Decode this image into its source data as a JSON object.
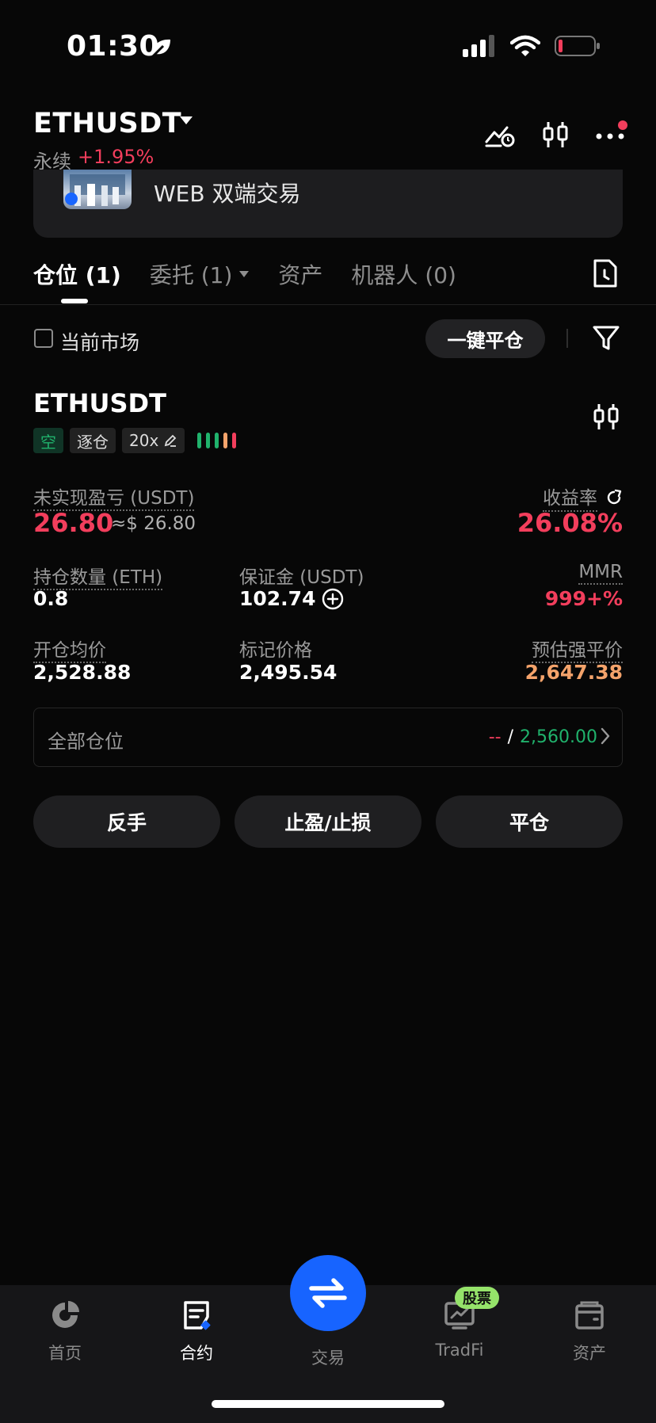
{
  "status_bar": {
    "time": "01:30"
  },
  "header": {
    "pair": "ETHUSDT",
    "contract_type": "永续",
    "change": "+1.95%"
  },
  "banner": {
    "text": "WEB 双端交易"
  },
  "tabs": [
    {
      "label": "仓位 (1)",
      "active": true
    },
    {
      "label": "委托 (1)",
      "active": false
    },
    {
      "label": "资产",
      "active": false
    },
    {
      "label": "机器人 (0)",
      "active": false
    }
  ],
  "filter": {
    "current_market_label": "当前市场",
    "close_all_label": "一键平仓"
  },
  "position": {
    "pair": "ETHUSDT",
    "tags": {
      "side": "空",
      "margin_mode": "逐仓",
      "leverage": "20x"
    },
    "risk_bar_colors": [
      "#20b26c",
      "#20b26c",
      "#20b26c",
      "#f4a36b",
      "#f23e5c"
    ],
    "unrealized_pnl_label": "未实现盈亏 (USDT)",
    "unrealized_pnl": "26.80",
    "unrealized_pnl_approx": "≈$ 26.80",
    "roe_label": "收益率",
    "roe": "26.08%",
    "qty_label": "持仓数量 (ETH)",
    "qty": "0.8",
    "margin_label": "保证金 (USDT)",
    "margin": "102.74",
    "mmr_label": "MMR",
    "mmr": "999+%",
    "entry_label": "开仓均价",
    "entry": "2,528.88",
    "mark_label": "标记价格",
    "mark": "2,495.54",
    "liq_label": "预估强平价",
    "liq": "2,647.38",
    "all_positions_label": "全部仓位",
    "all_positions_left": "--",
    "all_positions_sep": "/",
    "all_positions_right": "2,560.00"
  },
  "actions": {
    "reverse": "反手",
    "tp_sl": "止盈/止损",
    "close": "平仓"
  },
  "nav": {
    "home": "首页",
    "futures": "合约",
    "trade": "交易",
    "tradfi": "TradFi",
    "tradfi_badge": "股票",
    "assets": "资产"
  },
  "colors": {
    "accent": "#1764ff",
    "red": "#f23e5c",
    "green": "#20b26c",
    "orange": "#f4a36b"
  }
}
